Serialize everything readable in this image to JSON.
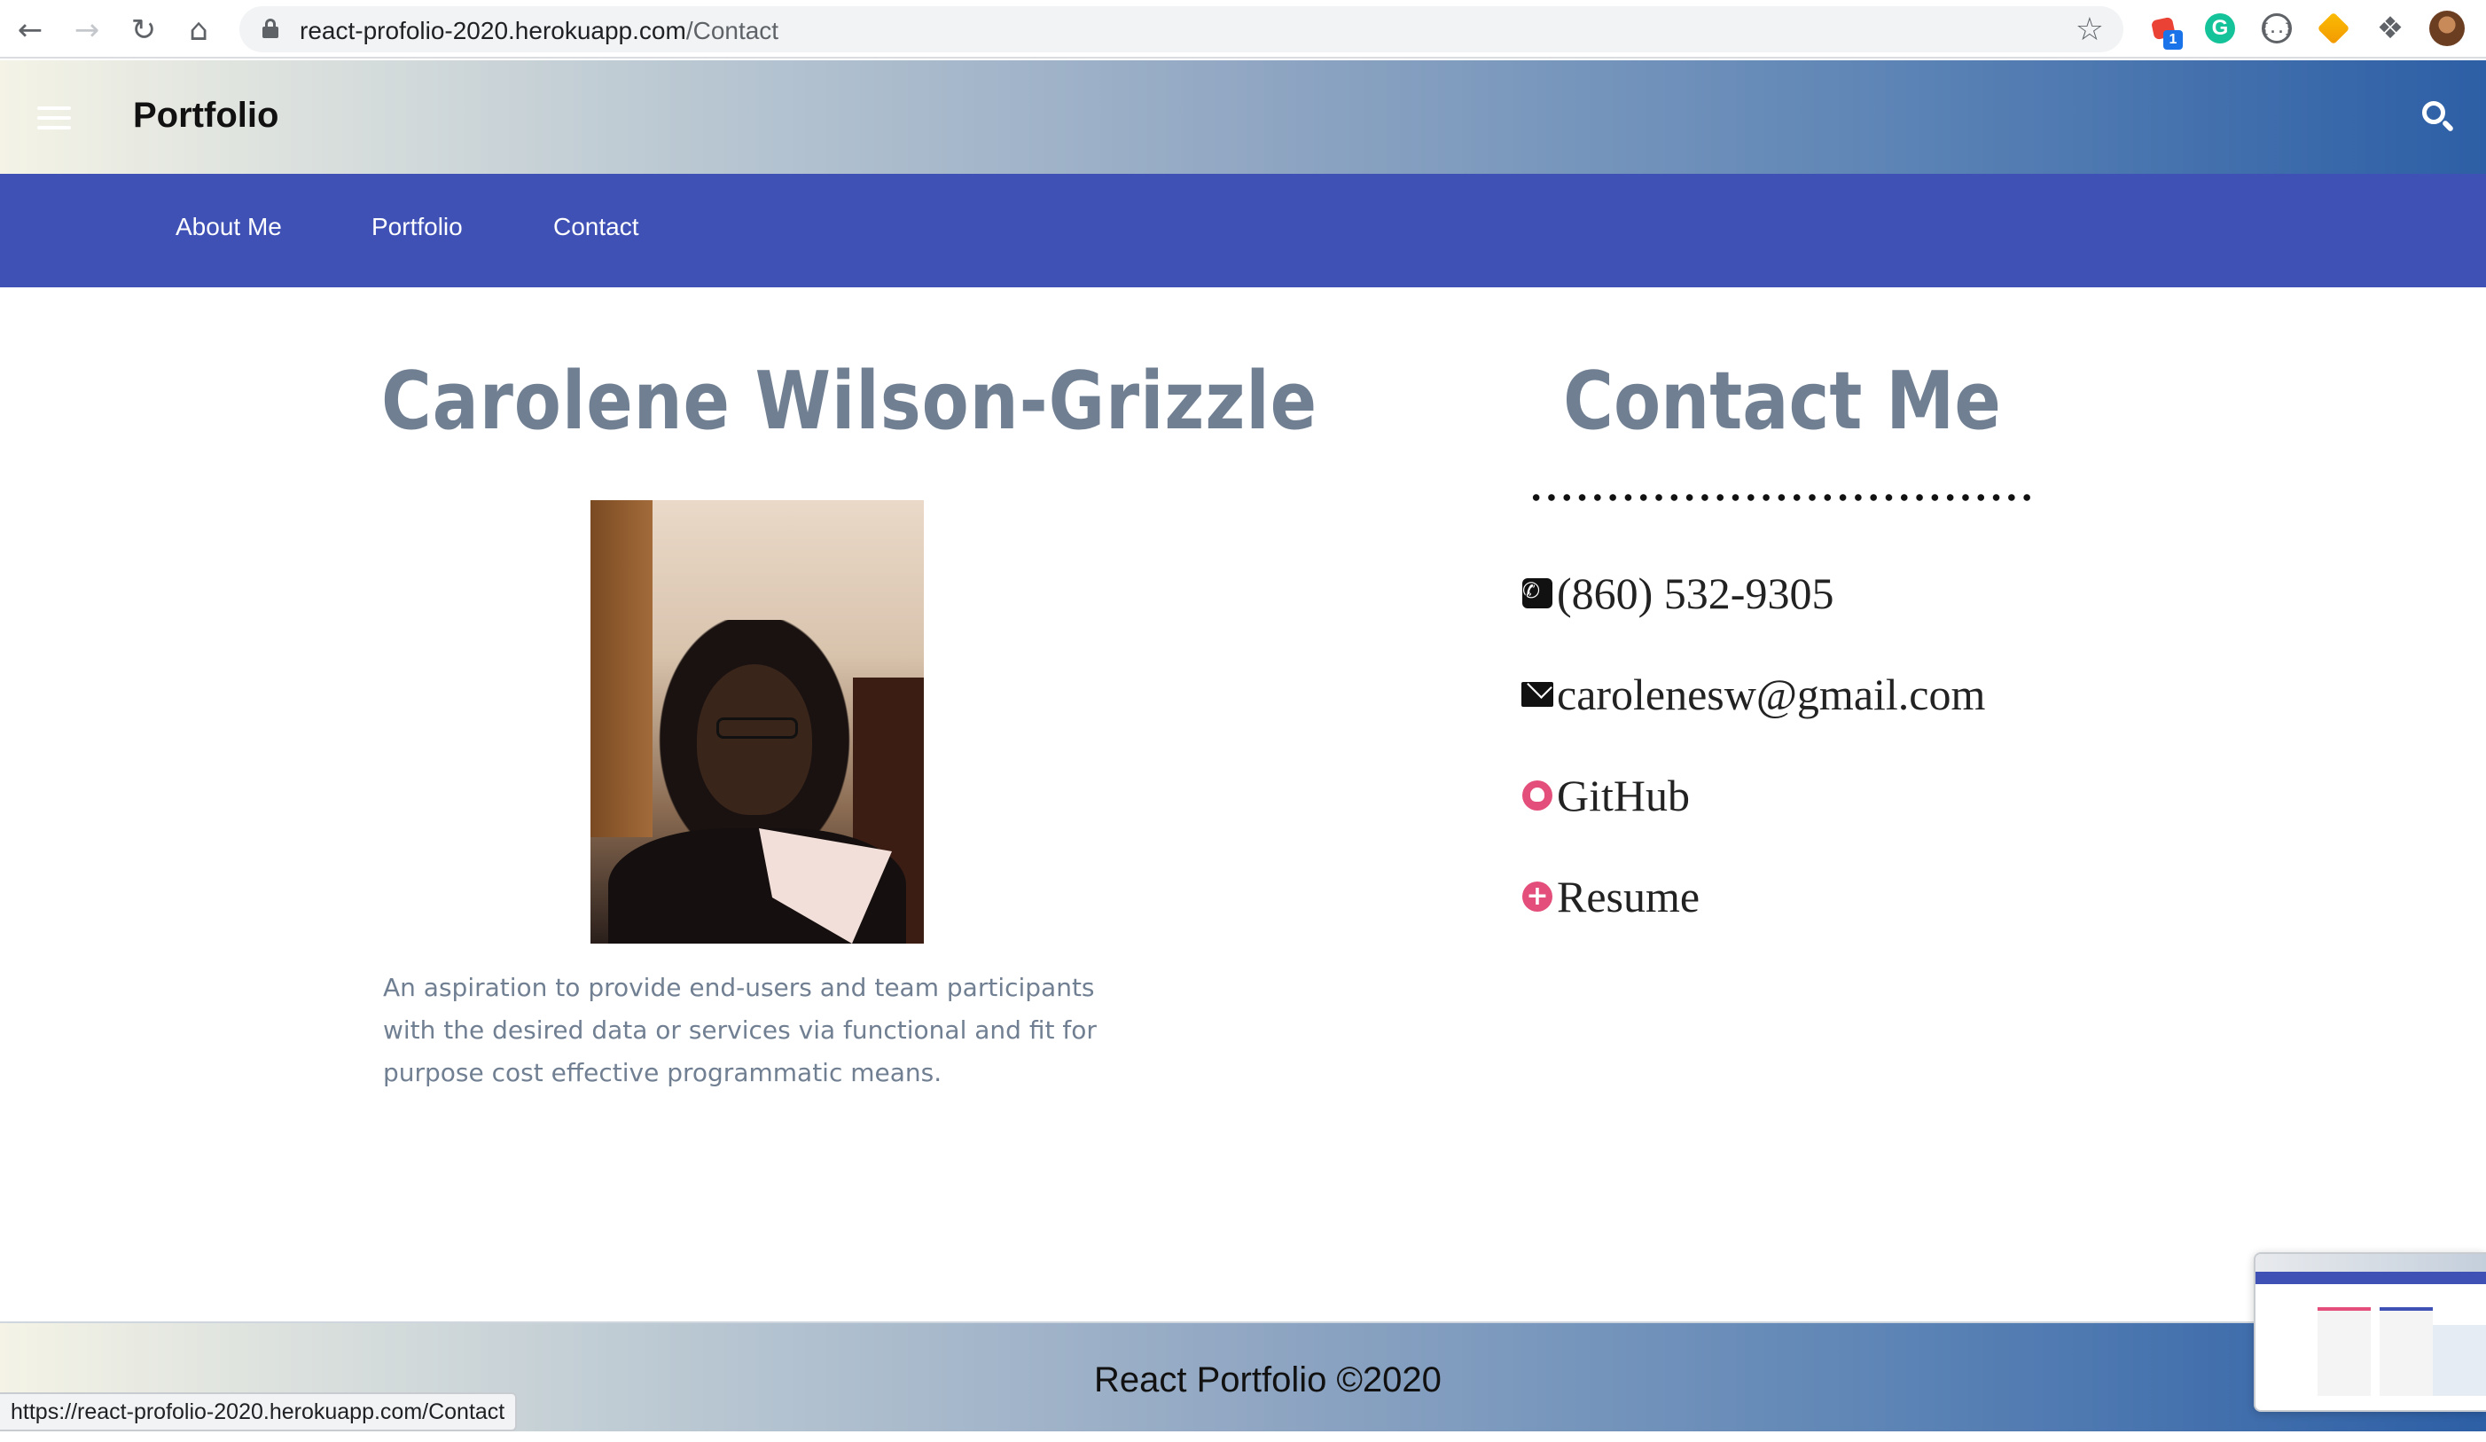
{
  "browser": {
    "url_host": "react-profolio-2020.herokuapp.com",
    "url_path": "/Contact",
    "extension_badge": "1",
    "extension_g_letter": "G"
  },
  "app": {
    "brand": "Portfolio",
    "tabs": [
      "About Me",
      "Portfolio",
      "Contact"
    ]
  },
  "profile": {
    "name": "Carolene Wilson-Grizzle",
    "bio": "An aspiration to provide end-users and team participants with the desired data or services via functional and fit for purpose cost effective programmatic means."
  },
  "contact": {
    "heading": "Contact Me",
    "items": [
      {
        "icon": "phone-icon",
        "label": "(860) 532-9305"
      },
      {
        "icon": "envelope-icon",
        "label": "carolenesw@gmail.com"
      },
      {
        "icon": "github-icon",
        "label": "GitHub"
      },
      {
        "icon": "plus-circle-icon",
        "label": "Resume"
      }
    ]
  },
  "footer": {
    "text": "React Portfolio ©2020"
  },
  "status_bar": {
    "link_url": "https://react-profolio-2020.herokuapp.com/Contact"
  },
  "colors": {
    "nav_blue": "#3f51b5",
    "heading_gray": "#707f92",
    "accent_pink": "#e34f7a"
  }
}
